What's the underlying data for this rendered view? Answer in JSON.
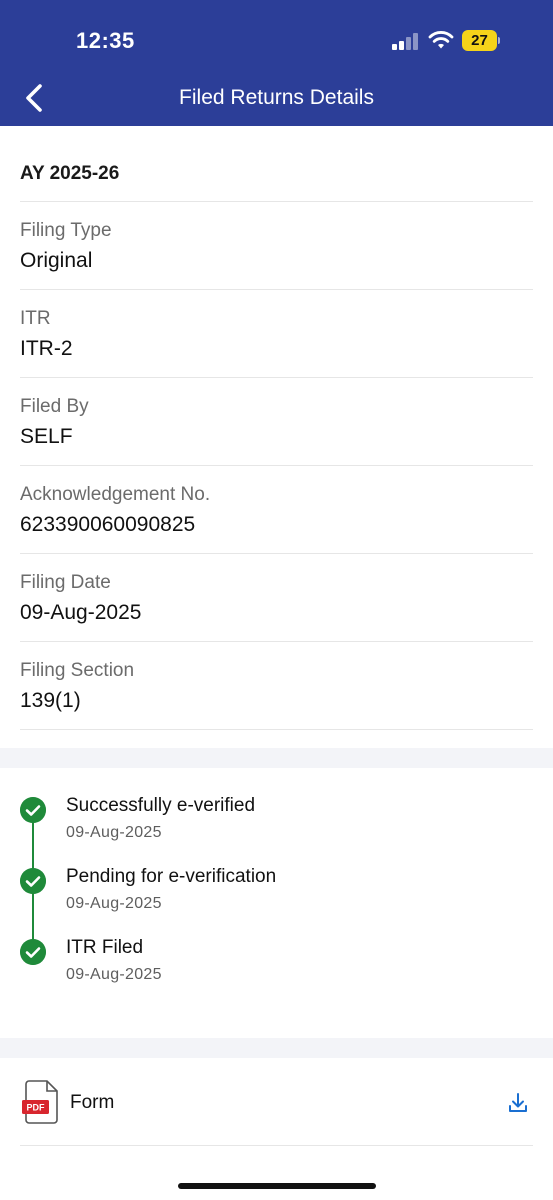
{
  "status_bar": {
    "time": "12:35",
    "battery": "27"
  },
  "nav": {
    "title": "Filed Returns Details"
  },
  "details": {
    "assessment_year": "AY 2025-26",
    "fields": [
      {
        "label": "Filing Type",
        "value": "Original"
      },
      {
        "label": "ITR",
        "value": "ITR-2"
      },
      {
        "label": "Filed By",
        "value": "SELF"
      },
      {
        "label": "Acknowledgement No.",
        "value": "623390060090825"
      },
      {
        "label": "Filing Date",
        "value": "09-Aug-2025"
      },
      {
        "label": "Filing Section",
        "value": "139(1)"
      }
    ]
  },
  "timeline": [
    {
      "title": "Successfully e-verified",
      "date": "09-Aug-2025"
    },
    {
      "title": "Pending for e-verification",
      "date": "09-Aug-2025"
    },
    {
      "title": "ITR Filed",
      "date": "09-Aug-2025"
    }
  ],
  "form": {
    "label": "Form",
    "pdf_badge": "PDF"
  },
  "colors": {
    "header": "#2c3e98",
    "success": "#1f8a3a",
    "pdf_red": "#d8262e",
    "link_blue": "#1a6fd1"
  },
  "icons": {
    "back": "chevron-left-icon",
    "check": "check-circle-icon",
    "pdf": "pdf-file-icon",
    "download": "download-icon"
  }
}
